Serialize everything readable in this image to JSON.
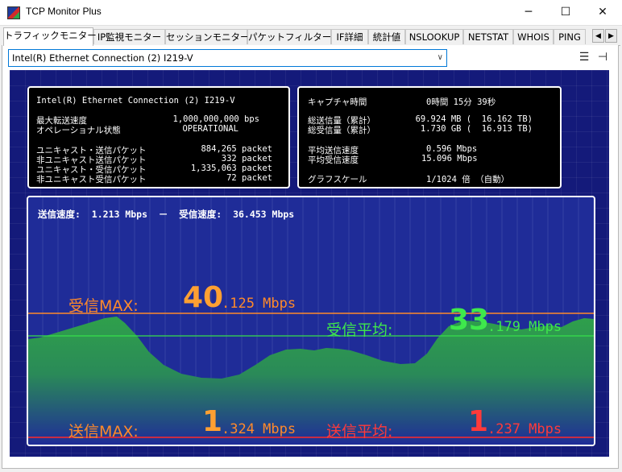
{
  "window": {
    "title": "TCP Monitor Plus",
    "minimize": "─",
    "maximize": "☐",
    "close": "✕"
  },
  "tabs": [
    {
      "label": "トラフィックモニター"
    },
    {
      "label": "IP監視モニター"
    },
    {
      "label": "セッションモニター"
    },
    {
      "label": "パケットフィルター"
    },
    {
      "label": "IF詳細"
    },
    {
      "label": "統計値"
    },
    {
      "label": "NSLOOKUP"
    },
    {
      "label": "NETSTAT"
    },
    {
      "label": "WHOIS"
    },
    {
      "label": "PING"
    }
  ],
  "tab_scroll": {
    "left": "◀",
    "right": "▶"
  },
  "adapter": {
    "selected": "Intel(R) Ethernet Connection (2) I219-V"
  },
  "toolbar": {
    "list_icon": "☰",
    "pin_icon": "⊣"
  },
  "info_left": {
    "adapter_name": "Intel(R) Ethernet Connection (2) I219-V",
    "max_speed_label": "最大転送速度",
    "max_speed_value": "1,000,000,000 bps",
    "op_state_label": "オペレーショナル状態",
    "op_state_value": "OPERATIONAL",
    "ucast_out_label": "ユニキャスト・送信パケット",
    "ucast_out_value": "884,265 packet",
    "nucast_out_label": "非ユニキャスト送信パケット",
    "nucast_out_value": "332 packet",
    "ucast_in_label": "ユニキャスト・受信パケット",
    "ucast_in_value": "1,335,063 packet",
    "nucast_in_label": "非ユニキャスト受信パケット",
    "nucast_in_value": "72 packet"
  },
  "info_right": {
    "capture_label": "キャプチャ時間",
    "capture_value": "0時間 15分 39秒",
    "total_sent_label": "総送信量（累計）",
    "total_sent_value": "69.924 MB (  16.162 TB)",
    "total_recv_label": "総受信量（累計）",
    "total_recv_value": "1.730 GB (  16.913 TB)",
    "avg_send_label": "平均送信速度",
    "avg_send_value": "0.596 Mbps",
    "avg_recv_label": "平均受信速度",
    "avg_recv_value": "15.096 Mbps",
    "scale_label": "グラフスケール",
    "scale_value": "1/1024 倍 （自動）"
  },
  "graph": {
    "send_speed_label": "送信速度:",
    "send_speed_value": "1.213 Mbps",
    "separator": "－",
    "recv_speed_label": "受信速度:",
    "recv_speed_value": "36.453 Mbps",
    "recv_max_label": "受信MAX:",
    "recv_max_int": "40",
    "recv_max_dec": ".125 Mbps",
    "recv_avg_label": "受信平均:",
    "recv_avg_int": "33",
    "recv_avg_dec": ".179 Mbps",
    "send_max_label": "送信MAX:",
    "send_max_int": "1",
    "send_max_dec": ".324 Mbps",
    "send_avg_label": "送信平均:",
    "send_avg_int": "1",
    "send_avg_dec": ".237 Mbps",
    "colors": {
      "background": "#1f2c98",
      "recv_fill": "#2f9c4a",
      "recv_max_line": "#ff8a2a",
      "recv_avg_line": "#36e04a",
      "send_line": "#ff2a2a",
      "recv_max_text": "#ffa032",
      "recv_avg_text": "#3ee84c",
      "send_max_text": "#ff8a2a",
      "send_avg_text": "#ff3a3a"
    }
  }
}
